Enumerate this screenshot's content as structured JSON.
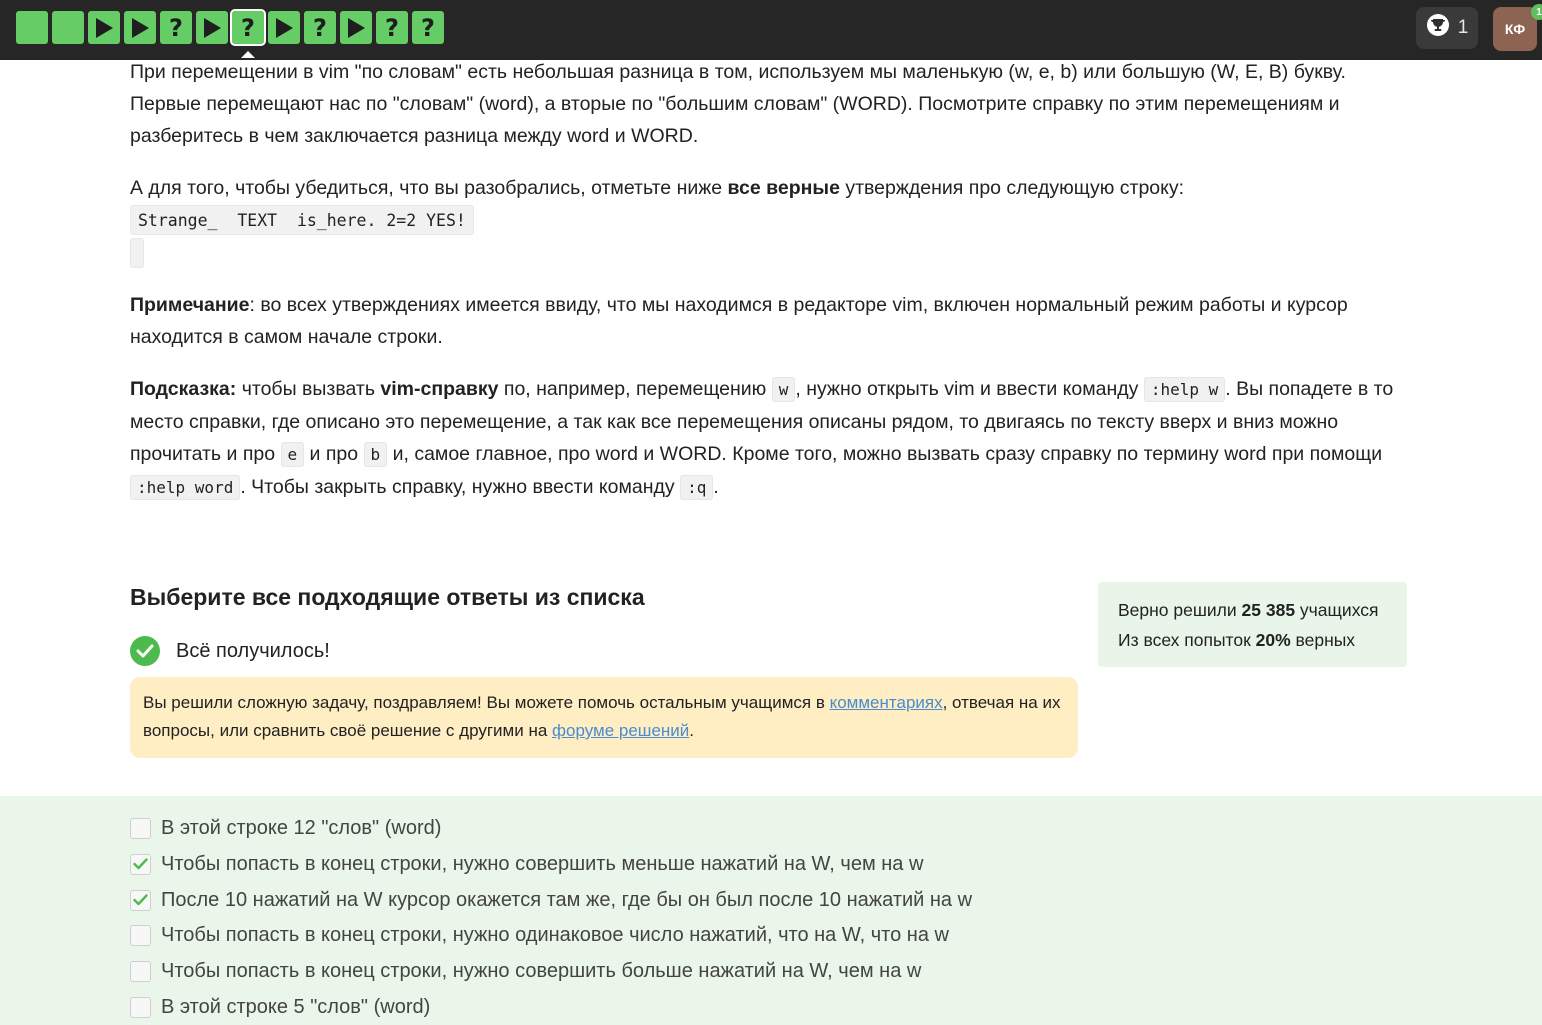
{
  "topbar": {
    "steps": [
      "done",
      "done",
      "play",
      "play",
      "quiz",
      "play",
      "quiz",
      "play",
      "quiz",
      "play",
      "quiz",
      "quiz"
    ],
    "current_step": 7,
    "step_color": "#66cc66",
    "trophy_count": "1",
    "avatar_initials": "КФ",
    "avatar_badge": "1"
  },
  "intro": {
    "p1": "При перемещении в vim \"по словам\" есть небольшая разница в том, используем мы маленькую (w, e, b) или большую (W, E, B) букву. Первые перемещают нас по \"словам\" (word), а вторые по \"большим словам\" (WORD). Посмотрите справку по этим перемещениям и разберитесь в чем заключается разница между word и WORD.",
    "p2_before": "А для того, чтобы убедиться, что вы разобрались, отметьте ниже ",
    "p2_bold": "все верные",
    "p2_after": " утверждения про следующую строку:",
    "sample": "Strange_  TEXT  is_here. 2=2 YES!",
    "note_label": "Примечание",
    "note_text": ": во всех утверждениях имеется ввиду, что мы находимся в редакторе vim, включен нормальный режим работы и курсор находится в самом начале строки.",
    "hint_label": "Подсказка:",
    "hint_t1": " чтобы вызвать ",
    "hint_bold": "vim-справку",
    "hint_t2": " по, например, перемещению ",
    "hint_c1": "w",
    "hint_t3": ", нужно открыть vim и ввести команду ",
    "hint_c2": ":help w",
    "hint_t4": ". Вы попадете в то место справки, где описано это перемещение, а так как все перемещения описаны рядом, то двигаясь по тексту вверх и вниз можно прочитать и про ",
    "hint_c3": "e",
    "hint_t5": " и про ",
    "hint_c4": "b",
    "hint_t6": " и, самое главное, про word и WORD. Кроме того, можно вызвать сразу справку по термину word при помощи ",
    "hint_c5": ":help word",
    "hint_t7": ". Чтобы закрыть справку, нужно ввести команду ",
    "hint_c6": ":q",
    "hint_t8": "."
  },
  "quiz": {
    "title": "Выберите все подходящие ответы из списка",
    "success": "Всё получилось!",
    "notice_t1": "Вы решили сложную задачу, поздравляем! Вы можете помочь остальным учащимся в ",
    "notice_link1": "комментариях",
    "notice_t2": ", отвечая на их вопросы, или сравнить своё решение с другими на ",
    "notice_link2": "форуме решений",
    "notice_t3": ".",
    "stats_l1_before": "Верно решили ",
    "stats_l1_bold": "25 385",
    "stats_l1_after": " учащихся",
    "stats_l2_before": "Из всех попыток ",
    "stats_l2_bold": "20%",
    "stats_l2_after": " верных",
    "options": [
      {
        "label": "В этой строке 12 \"слов\" (word)",
        "checked": false
      },
      {
        "label": "Чтобы попасть в конец строки, нужно совершить меньше нажатий на W, чем на w",
        "checked": true
      },
      {
        "label": "После 10 нажатий на W курсор окажется там же, где бы он был после 10 нажатий на w",
        "checked": true
      },
      {
        "label": "Чтобы попасть в конец строки, нужно одинаковое число нажатий, что на W, что на w",
        "checked": false
      },
      {
        "label": "Чтобы попасть в конец строки, нужно совершить больше нажатий на W, чем на w",
        "checked": false
      },
      {
        "label": "В этой строке 5 \"слов\" (word)",
        "checked": false
      }
    ]
  }
}
